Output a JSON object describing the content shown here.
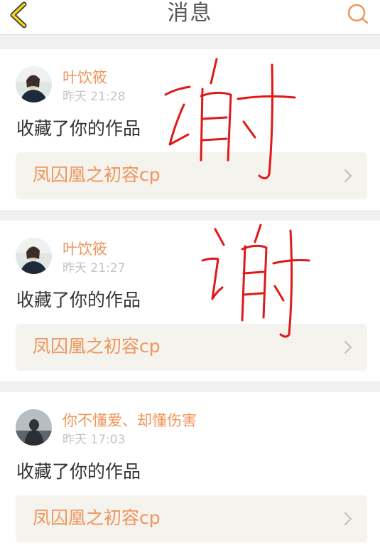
{
  "header": {
    "title": "消息",
    "back_icon": "chevron-left-icon",
    "search_icon": "search-icon",
    "accent_color": "#f5c518",
    "search_color": "#f0955a"
  },
  "messages": [
    {
      "username": "叶饮筱",
      "time": "昨天 21:28",
      "action": "收藏了你的作品",
      "work_title": "凤囚凰之初容cp"
    },
    {
      "username": "叶饮筱",
      "time": "昨天 21:27",
      "action": "收藏了你的作品",
      "work_title": "凤囚凰之初容cp"
    },
    {
      "username": "你不懂爱、却懂伤害",
      "time": "昨天 17:03",
      "action": "收藏了你的作品",
      "work_title": "凤囚凰之初容cp"
    }
  ],
  "handwriting": [
    "谢",
    "谢"
  ],
  "colors": {
    "username": "#f0955a",
    "time": "#c4c4c4",
    "scribble": "#e01818"
  }
}
